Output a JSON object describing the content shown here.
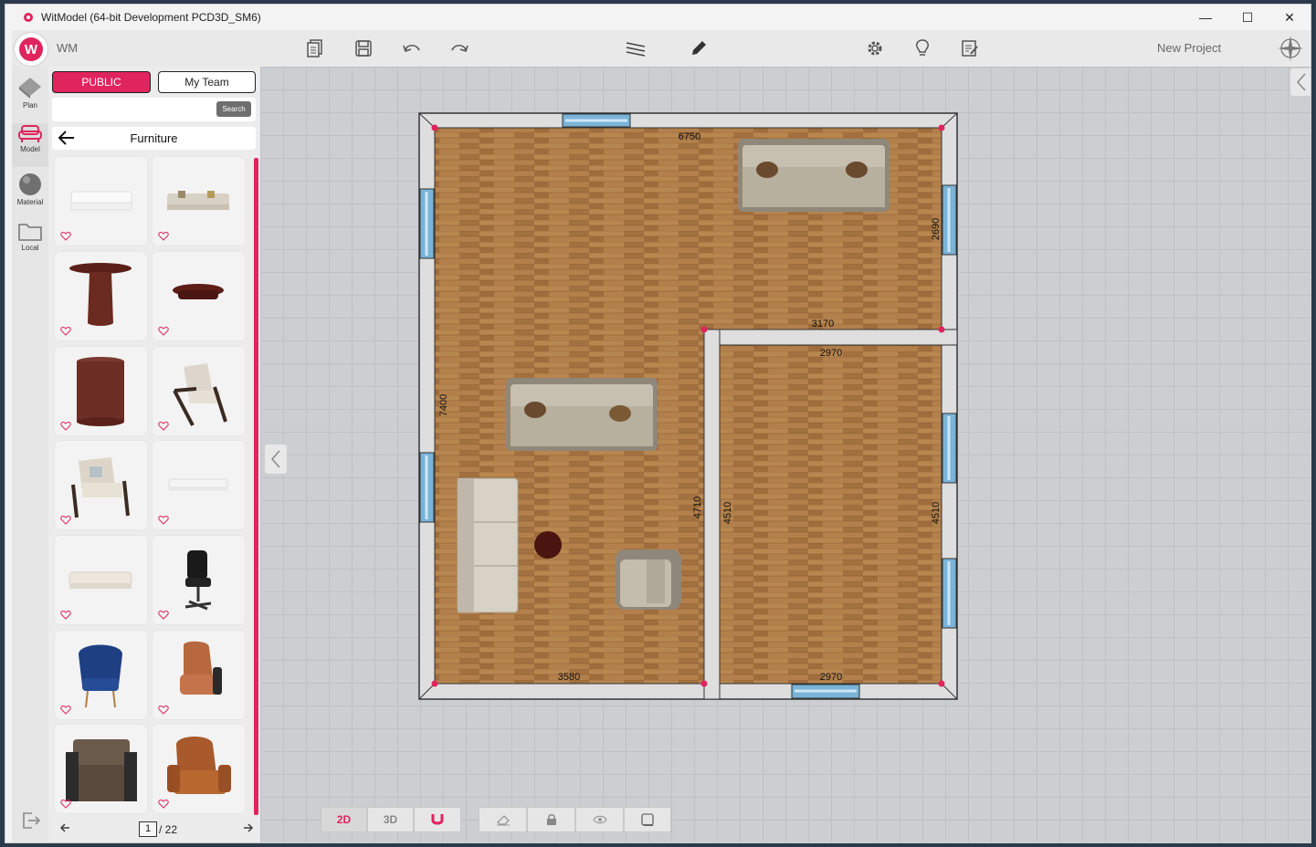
{
  "window": {
    "title": "WitModel (64-bit Development PCD3D_SM6)",
    "controls": [
      "—",
      "☐",
      "✕"
    ]
  },
  "toolbar": {
    "logo_letter": "W",
    "brand": "WM",
    "project": "New Project"
  },
  "leftnav": {
    "items": [
      {
        "label": "Plan",
        "icon": "plan-icon"
      },
      {
        "label": "Model",
        "icon": "sofa-icon"
      },
      {
        "label": "Material",
        "icon": "material-icon"
      },
      {
        "label": "Local",
        "icon": "folder-icon"
      }
    ]
  },
  "panel": {
    "public_label": "PUBLIC",
    "team_label": "My Team",
    "search_placeholder": "",
    "search_label": "Search",
    "category": "Furniture",
    "page_current": "1",
    "page_total": "/ 22",
    "items": [
      {
        "name": "white-sofa"
      },
      {
        "name": "beige-sofa"
      },
      {
        "name": "round-pedestal-table"
      },
      {
        "name": "oval-coffee-table"
      },
      {
        "name": "wood-stump-table"
      },
      {
        "name": "lounge-armchair"
      },
      {
        "name": "cream-armchair"
      },
      {
        "name": "low-white-sofa"
      },
      {
        "name": "cream-sofa"
      },
      {
        "name": "office-chair"
      },
      {
        "name": "blue-velvet-chair"
      },
      {
        "name": "tan-leather-recliner"
      },
      {
        "name": "brown-club-chair"
      },
      {
        "name": "leather-recliner"
      }
    ]
  },
  "plan": {
    "dimensions": {
      "top": "6750",
      "right_upper": "2690",
      "mid_top": "3170",
      "room2_top": "2970",
      "left": "7400",
      "divider": "4710",
      "room2_left": "4510",
      "room2_right": "4510",
      "bottom_left": "3580",
      "bottom_right": "2970"
    }
  },
  "bottombar": {
    "mode_2d": "2D",
    "mode_3d": "3D"
  },
  "colors": {
    "accent": "#e0245e",
    "wall": "#d9d9d9",
    "floor": "#b07c48",
    "canvas": "#cdced2"
  }
}
